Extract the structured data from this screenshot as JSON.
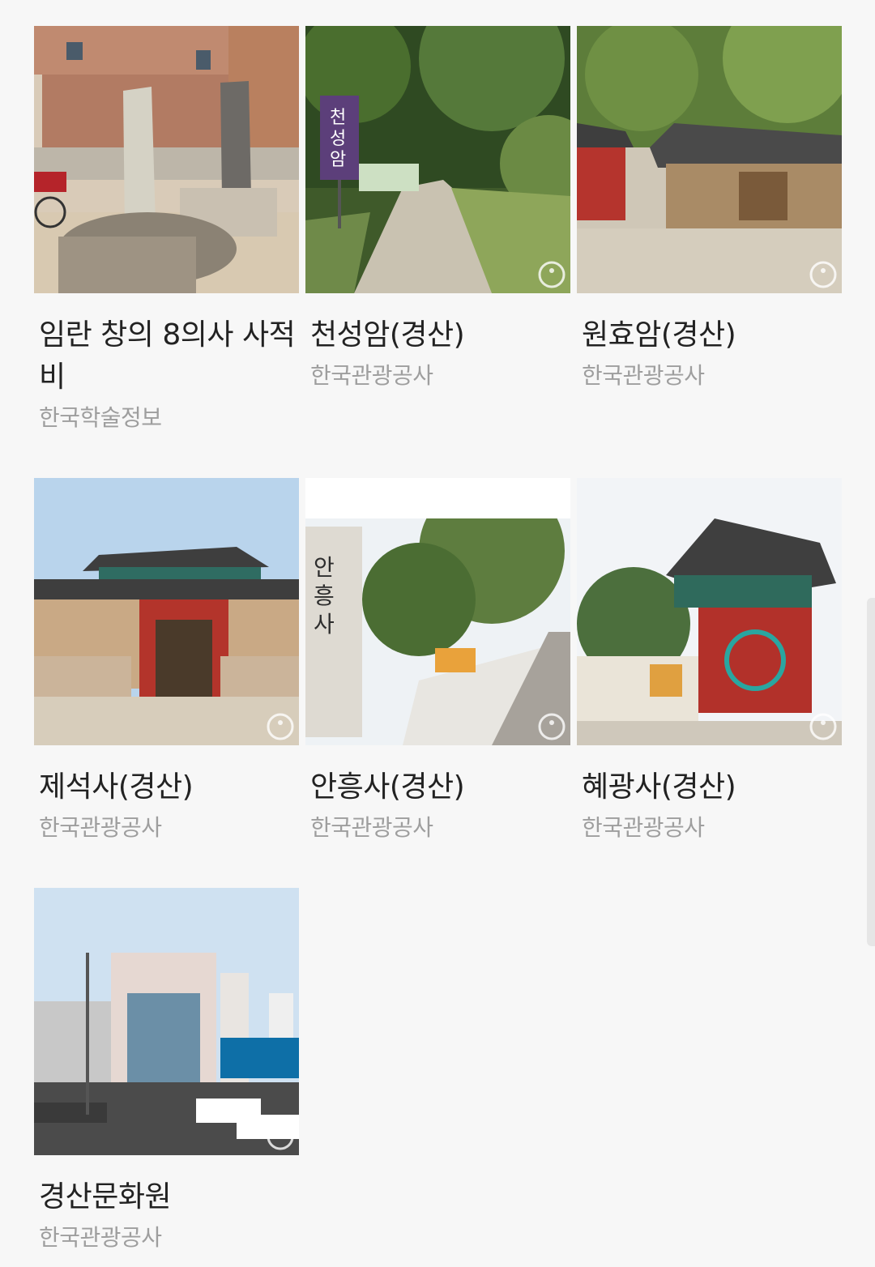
{
  "cards": [
    {
      "title": "임란 창의 8의사 사적비",
      "source": "한국학술정보",
      "image": "memorial-stele-photo"
    },
    {
      "title": "천성암(경산)",
      "source": "한국관광공사",
      "image": "mountain-path-signpost-photo"
    },
    {
      "title": "원효암(경산)",
      "source": "한국관광공사",
      "image": "temple-hall-courtyard-photo"
    },
    {
      "title": "제석사(경산)",
      "source": "한국관광공사",
      "image": "temple-gate-photo"
    },
    {
      "title": "안흥사(경산)",
      "source": "한국관광공사",
      "image": "temple-stone-sign-stairs-photo"
    },
    {
      "title": "혜광사(경산)",
      "source": "한국관광공사",
      "image": "temple-gate-manja-photo"
    },
    {
      "title": "경산문화원",
      "source": "한국관광공사",
      "image": "cultural-center-building-photo"
    }
  ],
  "overlay_text": {
    "cheonseongam_sign": "천성암",
    "anheungsa_sign": "안흥사"
  },
  "colors": {
    "title": "#222222",
    "source": "#9e9e9e",
    "background": "#f7f7f7"
  }
}
